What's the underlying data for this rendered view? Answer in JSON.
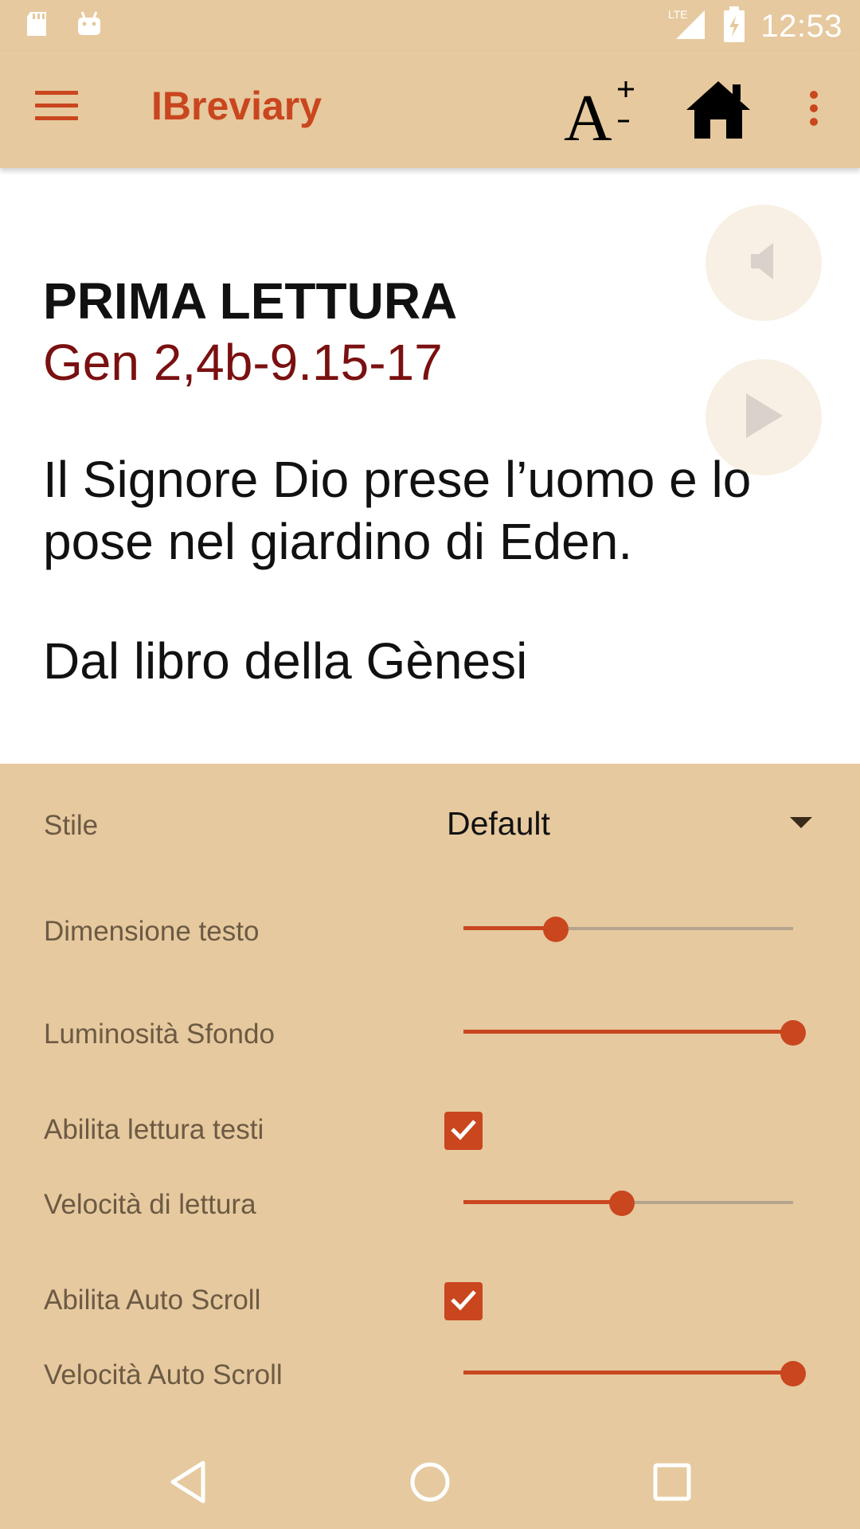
{
  "status_bar": {
    "time": "12:53",
    "network_label": "LTE",
    "icons": [
      "sd-card-icon",
      "android-icon",
      "signal-icon",
      "battery-icon"
    ]
  },
  "app_bar": {
    "title": "IBreviary",
    "actions": [
      "menu-icon",
      "font-size-icon",
      "home-icon",
      "more-icon"
    ]
  },
  "reading": {
    "heading": "PRIMA LETTURA",
    "reference": "Gen 2,4b-9.15-17",
    "summary": "Il Signore Dio prese l’uomo e lo pose nel giardino di Eden.",
    "source": "Dal libro della Gènesi"
  },
  "settings": {
    "style": {
      "label": "Stile",
      "value": "Default"
    },
    "text_size": {
      "label": "Dimensione testo",
      "value": 0.28
    },
    "background_brightness": {
      "label": "Luminosità Sfondo",
      "value": 1.0
    },
    "enable_reading": {
      "label": "Abilita lettura testi",
      "checked": true
    },
    "reading_speed": {
      "label": "Velocità di lettura",
      "value": 0.48
    },
    "enable_autoscroll": {
      "label": "Abilita Auto Scroll",
      "checked": true
    },
    "autoscroll_speed": {
      "label": "Velocità Auto Scroll",
      "value": 1.0
    }
  },
  "nav_bar": [
    "back-icon",
    "home-circle-icon",
    "recents-icon"
  ],
  "colors": {
    "background": "#e6c99e",
    "accent": "#c9461f",
    "reference": "#7a1010"
  }
}
